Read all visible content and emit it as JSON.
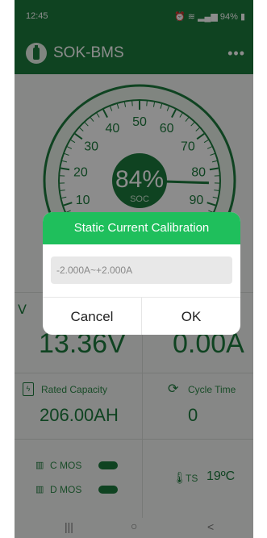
{
  "status": {
    "time": "12:45",
    "battery": "94%"
  },
  "app": {
    "title": "SOK-BMS"
  },
  "gauge": {
    "percent": "84%",
    "label": "SOC",
    "ticks": [
      "10",
      "20",
      "30",
      "40",
      "50",
      "60",
      "70",
      "80",
      "90"
    ],
    "soc_value": 84
  },
  "cells": {
    "voltage": "13.36V",
    "current": "0.00A",
    "rated_capacity_label": "Rated Capacity",
    "rated_capacity": "206.00AH",
    "cycle_time_label": "Cycle Time",
    "cycle_time": "0",
    "c_mos": "C MOS",
    "d_mos": "D MOS",
    "ts_label": "TS",
    "ts_value": "19ºC"
  },
  "dialog": {
    "title": "Static Current Calibration",
    "placeholder": "-2.000A~+2.000A",
    "cancel": "Cancel",
    "ok": "OK"
  },
  "nav": {
    "recent": "|||",
    "home": "○",
    "back": "<"
  },
  "colors": {
    "brand": "#1c7a3c",
    "dialog_header": "#1fbf5c"
  }
}
